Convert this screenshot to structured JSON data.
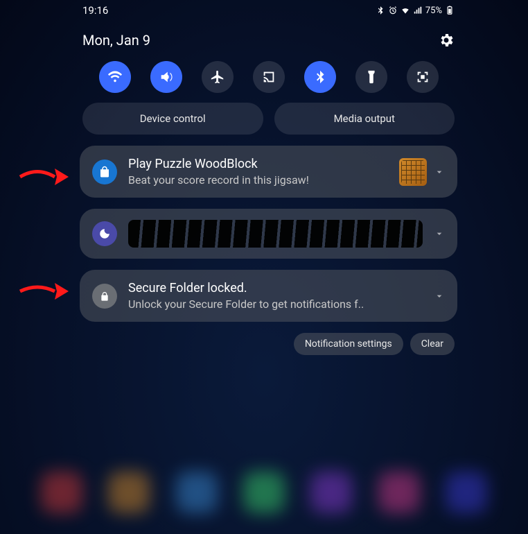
{
  "status": {
    "time": "19:16",
    "battery": "75%"
  },
  "header": {
    "date": "Mon, Jan 9"
  },
  "wide": {
    "device": "Device control",
    "media": "Media output"
  },
  "notifications": [
    {
      "title": "Play Puzzle WoodBlock",
      "text": "Beat your score record in this jigsaw!"
    },
    {
      "title": "",
      "text": ""
    },
    {
      "title": "Secure Folder locked.",
      "text": "Unlock your Secure Folder to get notifications f.."
    }
  ],
  "footer": {
    "settings": "Notification settings",
    "clear": "Clear"
  },
  "icons": {
    "wifi": "wifi",
    "sound": "sound",
    "airplane": "airplane",
    "cast": "cast",
    "bluetooth": "bluetooth",
    "flashlight": "flashlight",
    "screenshot": "screenshot"
  }
}
